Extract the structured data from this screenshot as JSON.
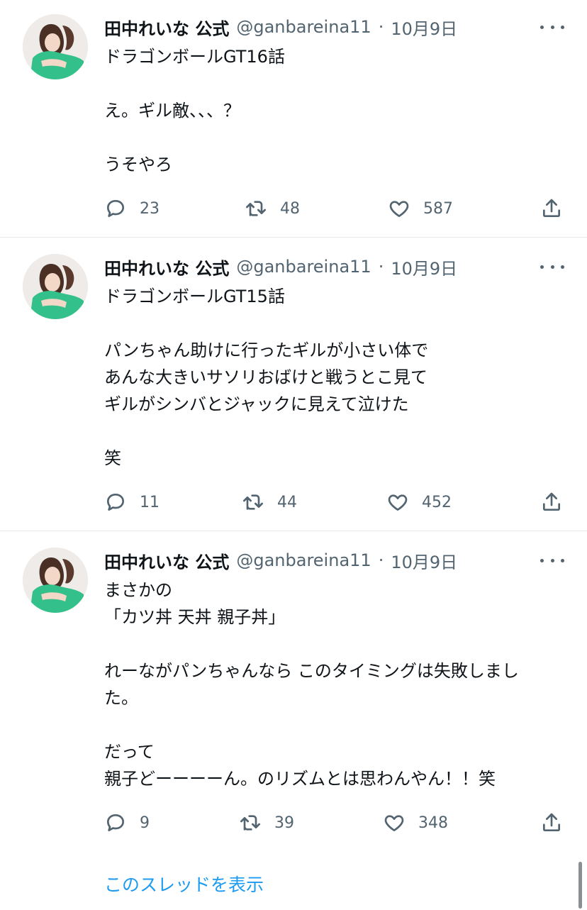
{
  "author": {
    "name": "田中れいな 公式",
    "handle": "@ganbareina11",
    "separator": "·"
  },
  "tweets": [
    {
      "date": "10月9日",
      "text": "ドラゴンボールGT16話\n\nえ。ギル敵、、、？\n\nうそやろ",
      "replies": "23",
      "retweets": "48",
      "likes": "587"
    },
    {
      "date": "10月9日",
      "text": "ドラゴンボールGT15話\n\nパンちゃん助けに行ったギルが小さい体で\nあんな大きいサソリおばけと戦うとこ見て\nギルがシンバとジャックに見えて泣けた\n\n笑",
      "replies": "11",
      "retweets": "44",
      "likes": "452"
    },
    {
      "date": "10月9日",
      "text": "まさかの\n「カツ丼 天丼 親子丼」\n\nれーながパンちゃんなら このタイミングは失敗しまし\nた。\n\nだって\n親子どーーーーん。のリズムとは思わんやん！！笑",
      "replies": "9",
      "retweets": "39",
      "likes": "348"
    }
  ],
  "thread_link": "このスレッドを表示",
  "colors": {
    "text": "#0f1419",
    "secondary": "#536471",
    "link": "#1d9bf0",
    "divider": "#e7eaec"
  },
  "icons": {
    "reply": "reply-icon",
    "retweet": "retweet-icon",
    "like": "heart-icon",
    "share": "share-icon",
    "more": "more-icon",
    "avatar": "avatar"
  }
}
